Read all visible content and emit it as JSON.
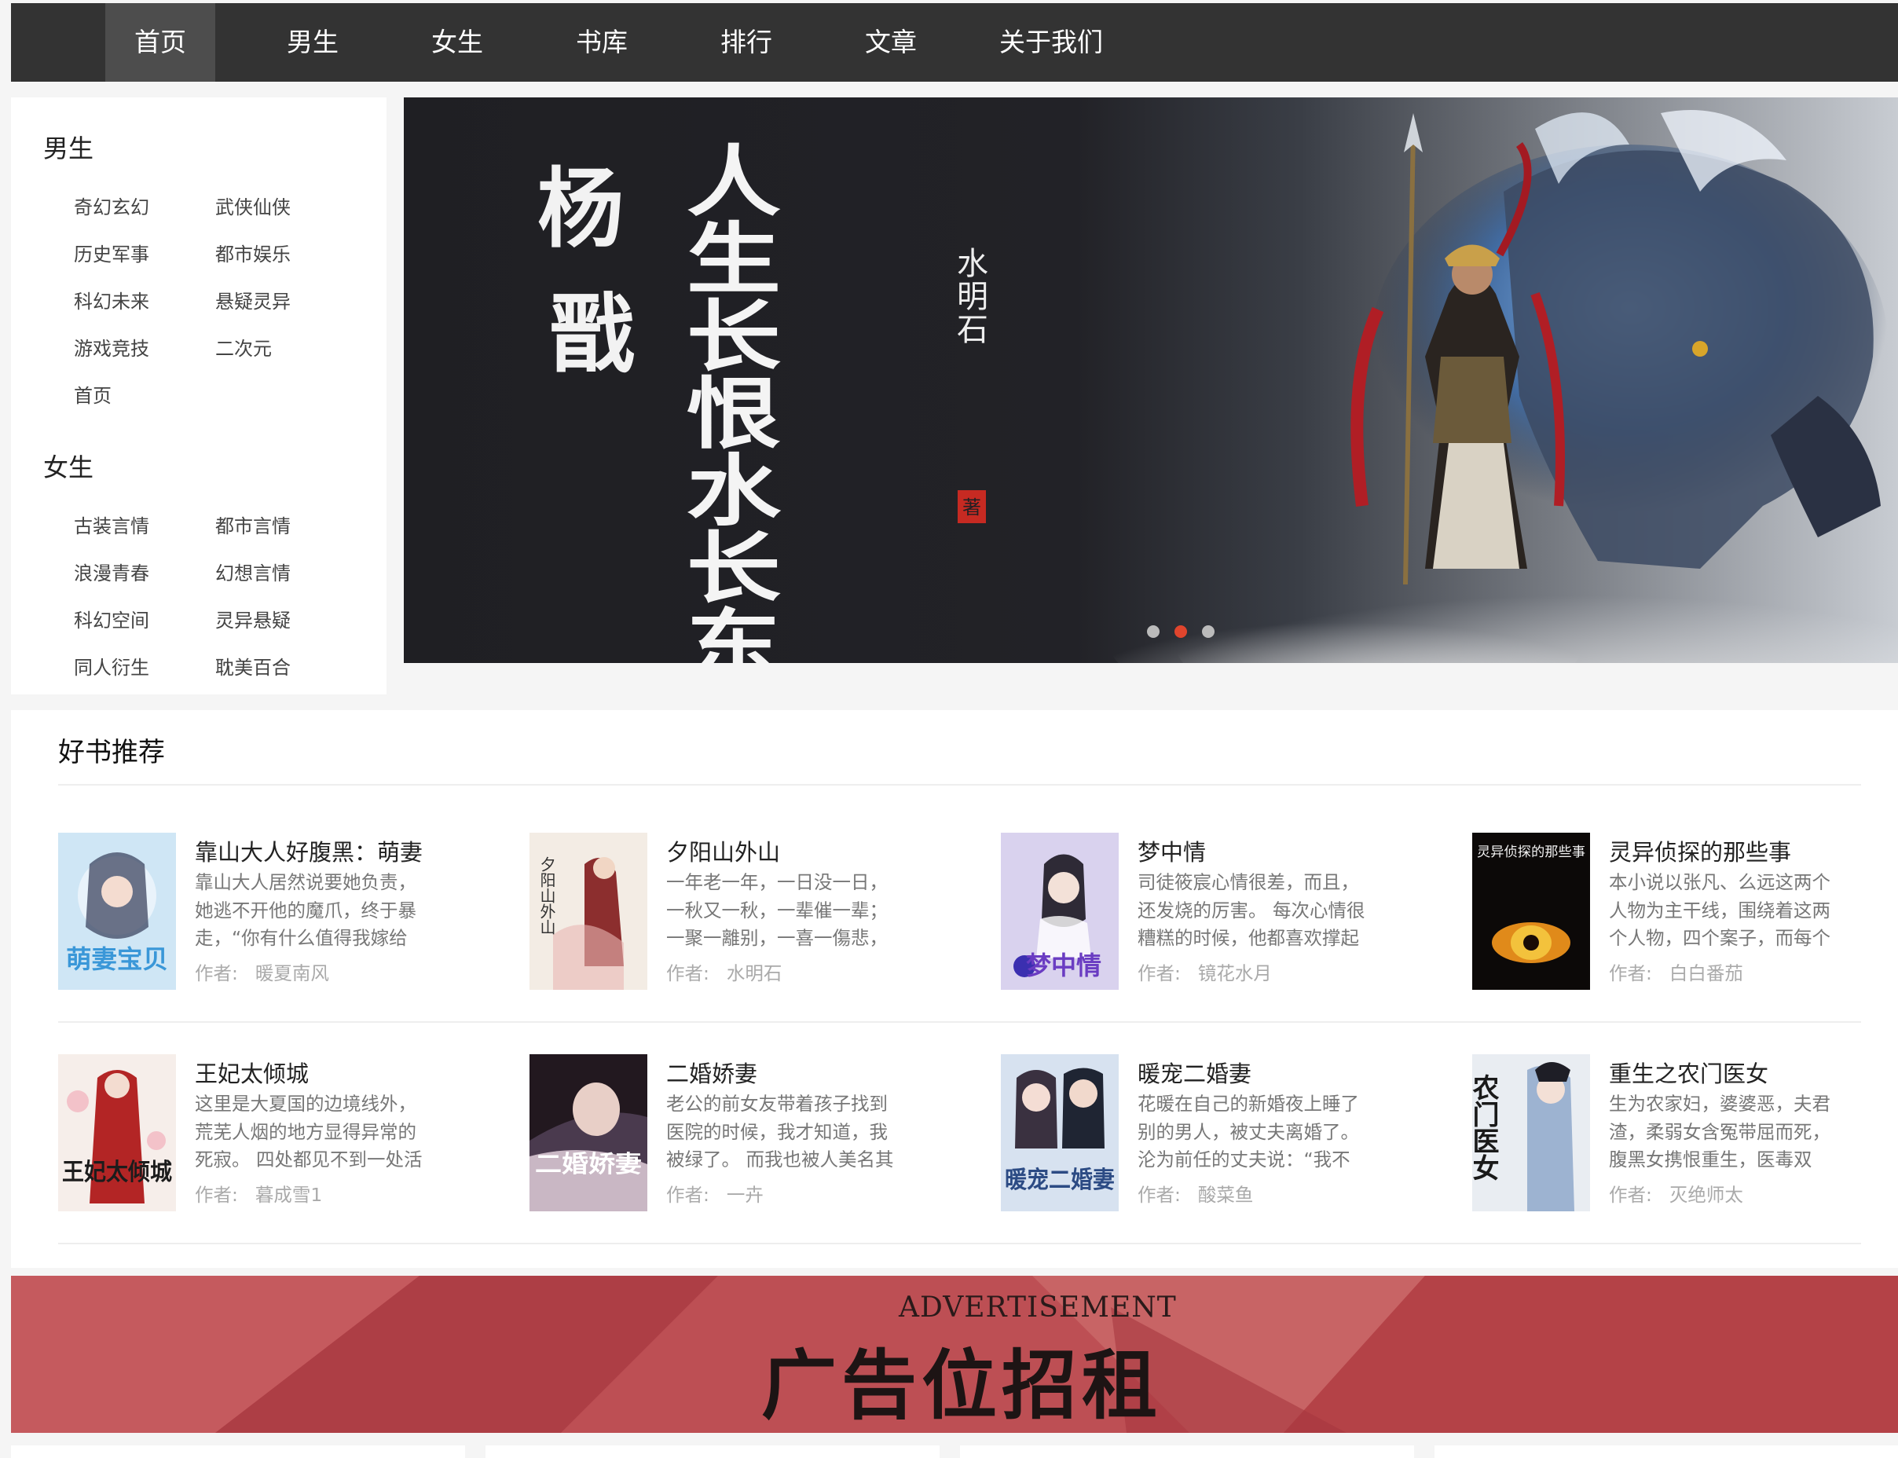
{
  "nav": {
    "items": [
      {
        "label": "首页",
        "active": true
      },
      {
        "label": "男生"
      },
      {
        "label": "女生"
      },
      {
        "label": "书库"
      },
      {
        "label": "排行"
      },
      {
        "label": "文章"
      },
      {
        "label": "关于我们"
      }
    ]
  },
  "sidebar": {
    "male_title": "男生",
    "male_links": [
      "奇幻玄幻",
      "武侠仙侠",
      "历史军事",
      "都市娱乐",
      "科幻未来",
      "悬疑灵异",
      "游戏竞技",
      "二次元",
      "首页"
    ],
    "female_title": "女生",
    "female_links": [
      "古装言情",
      "都市言情",
      "浪漫青春",
      "幻想言情",
      "科幻空间",
      "灵异悬疑",
      "同人衍生",
      "耽美百合"
    ]
  },
  "banner": {
    "art_title_1": "杨",
    "art_title_2": "戬",
    "art_title_3": "人生长恨水长东",
    "art_author": "水明石",
    "art_seal": "著",
    "dots": 3,
    "active_dot": 1
  },
  "recommend": {
    "title": "好书推荐",
    "author_label": "作者:",
    "books": [
      {
        "title": "靠山大人好腹黑：萌妻",
        "desc": "靠山大人居然说要她负责，她逃不开他的魔爪，终于暴走，“你有什么值得我嫁给",
        "author": "暖夏南风",
        "cover_text": "萌妻宝贝"
      },
      {
        "title": "夕阳山外山",
        "desc": "一年老一年，一日没一日，一秋又一秋，一辈催一辈；一聚一離别，一喜一傷悲，",
        "author": "水明石",
        "cover_text": "夕阳山外山"
      },
      {
        "title": "梦中情",
        "desc": "司徒筱宸心情很差，而且，还发烧的厉害。 每次心情很糟糕的时候，他都喜欢撑起",
        "author": "镜花水月",
        "cover_text": "梦中情"
      },
      {
        "title": "灵异侦探的那些事",
        "desc": "本小说以张凡、么远这两个人物为主干线，围绕着这两个人物，四个案子，而每个",
        "author": "白白番茄",
        "cover_text": "灵异侦探的那些事"
      },
      {
        "title": "王妃太倾城",
        "desc": "这里是大夏国的边境线外，荒芜人烟的地方显得异常的死寂。 四处都见不到一处活",
        "author": "暮成雪1",
        "cover_text": "王妃太倾城"
      },
      {
        "title": "二婚娇妻",
        "desc": "老公的前女友带着孩子找到医院的时候，我才知道，我被绿了。 而我也被人美名其",
        "author": "一卉",
        "cover_text": "二婚娇妻"
      },
      {
        "title": "暖宠二婚妻",
        "desc": "花暖在自己的新婚夜上睡了别的男人，被丈夫离婚了。沦为前任的丈夫说：“我不",
        "author": "酸菜鱼",
        "cover_text": "暖宠二婚妻"
      },
      {
        "title": "重生之农门医女",
        "desc": "生为农家妇，婆婆恶，夫君渣，柔弱女含冤带屈而死，腹黑女携恨重生，医毒双",
        "author": "灭绝师太",
        "cover_text": "农门医女"
      }
    ]
  },
  "ad": {
    "en": "ADVERTISEMENT",
    "cn": "广告位招租"
  },
  "colors": {
    "nav_bg": "#333333",
    "nav_active": "#4d4d4d",
    "dot_active": "#e0452d",
    "ad_bg": "#b8444a"
  }
}
